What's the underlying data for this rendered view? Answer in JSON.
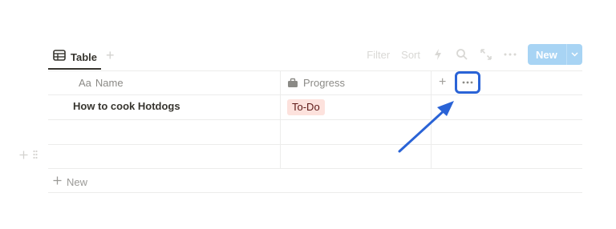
{
  "tabs": {
    "active_label": "Table",
    "add_symbol": "+"
  },
  "toolbar": {
    "filter_label": "Filter",
    "sort_label": "Sort",
    "icons": [
      "lightning-icon",
      "search-icon",
      "expand-icon",
      "more-icon"
    ],
    "new_label": "New"
  },
  "table": {
    "columns": [
      {
        "prefix": "Aa",
        "label": "Name",
        "icon": "text-type-icon"
      },
      {
        "label": "Progress",
        "icon": "status-icon"
      }
    ],
    "add_column_symbol": "+",
    "rows": [
      {
        "name": "How to cook Hotdogs",
        "progress": "To-Do"
      },
      {
        "name": "",
        "progress": ""
      },
      {
        "name": "",
        "progress": ""
      }
    ],
    "new_row_label": "New"
  },
  "colors": {
    "accent_highlight": "#2a63d6",
    "new_button": "#a8d4f4",
    "todo_tag_bg": "#fde2dd",
    "todo_tag_text": "#5d1715"
  }
}
